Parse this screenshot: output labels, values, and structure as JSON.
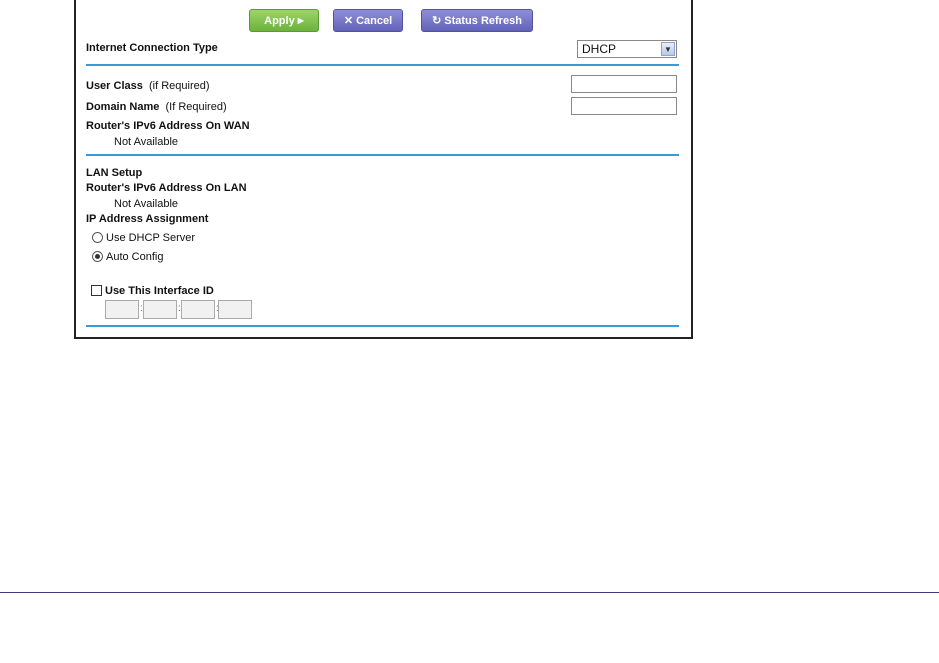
{
  "toolbar": {
    "apply_label": "Apply",
    "apply_icon": "▶",
    "cancel_icon": "✕",
    "cancel_label": "Cancel",
    "refresh_icon": "↻",
    "refresh_label": "Status Refresh",
    "apply_color": "#7cbf4a",
    "secondary_color": "#7272c4"
  },
  "connection": {
    "label": "Internet Connection Type",
    "selected": "DHCP"
  },
  "wan": {
    "user_class_label": "User Class",
    "user_class_hint": "(if Required)",
    "user_class_value": "",
    "domain_label": "Domain Name",
    "domain_hint": "(If Required)",
    "domain_value": "",
    "ipv6_wan_label": "Router's IPv6 Address On WAN",
    "ipv6_wan_value": "Not Available"
  },
  "lan": {
    "heading": "LAN Setup",
    "ipv6_lan_label": "Router's IPv6 Address On LAN",
    "ipv6_lan_value": "Not Available",
    "assignment_label": "IP Address Assignment",
    "options": [
      {
        "label": "Use DHCP Server",
        "selected": false
      },
      {
        "label": "Auto Config",
        "selected": true
      }
    ],
    "interface_id_label": "Use This Interface ID",
    "interface_id_checked": false,
    "interface_id_values": [
      "",
      "",
      "",
      ""
    ]
  },
  "accent_color": "#3a9bd0"
}
